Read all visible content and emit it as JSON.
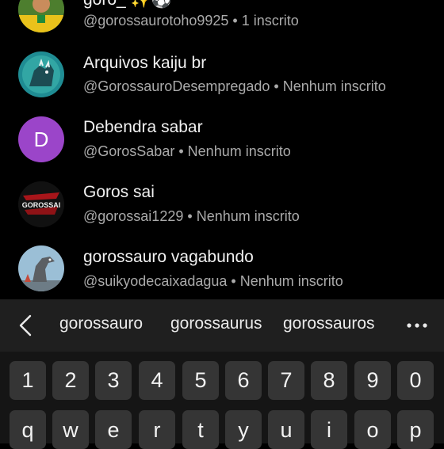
{
  "results": [
    {
      "name": "goro_ ✨⚽",
      "handle": "@gorossaurotoho9925",
      "subs": "1 inscrito",
      "avatar_icon": "soccer-player-icon"
    },
    {
      "name": "Arquivos kaiju br",
      "handle": "@GorossauroDesempregado",
      "subs": "Nenhum inscrito",
      "avatar_icon": "kaiju-icon"
    },
    {
      "name": "Debendra sabar",
      "handle": "@GorosSabar",
      "subs": "Nenhum inscrito",
      "avatar_letter": "D",
      "avatar_color": "#9b45c9"
    },
    {
      "name": "Goros sai",
      "handle": "@gorossai1229",
      "subs": "Nenhum inscrito",
      "avatar_icon": "gorossai-logo-icon",
      "avatar_text": "GOROSSAI"
    },
    {
      "name": "gorossauro vagabundo",
      "handle": "@suikyodecaixadagua",
      "subs": "Nenhum inscrito",
      "avatar_icon": "dinosaur-icon"
    }
  ],
  "separator": "•",
  "suggestions": [
    "gorossauro",
    "gorossaurus",
    "gorossauros"
  ],
  "number_keys": [
    "1",
    "2",
    "3",
    "4",
    "5",
    "6",
    "7",
    "8",
    "9",
    "0"
  ],
  "letter_keys": [
    "q",
    "w",
    "e",
    "r",
    "t",
    "y",
    "u",
    "i",
    "o",
    "p"
  ],
  "colors": {
    "background": "#000000",
    "suggest_bar": "#1f1f1f",
    "key": "#353535",
    "meta_text": "#aaaaaa"
  }
}
